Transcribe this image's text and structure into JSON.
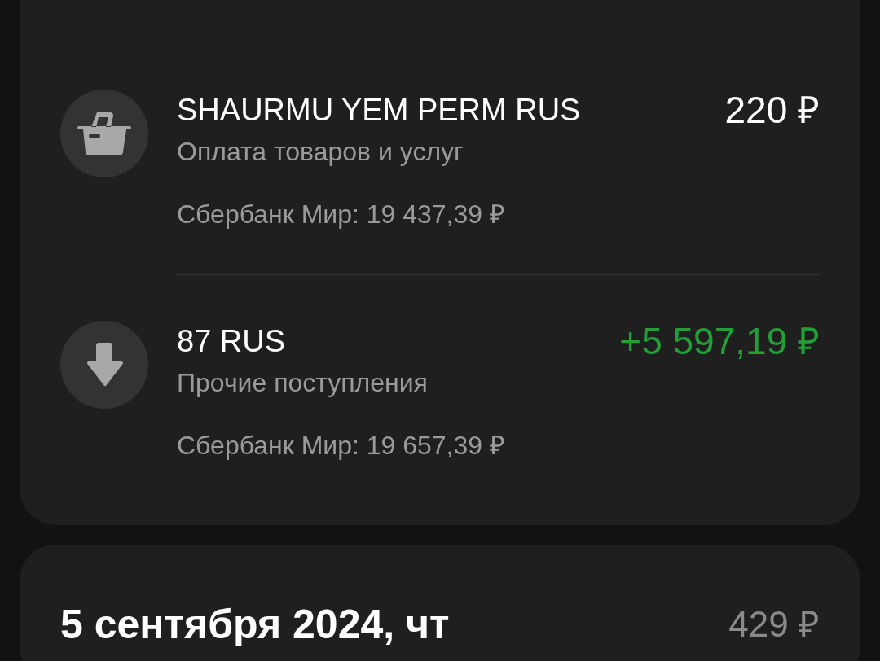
{
  "days": [
    {
      "transactions": [
        {
          "kind": "purchase",
          "title": "SHAURMU YEM PERM RUS",
          "amount": "220 ₽",
          "category": "Оплата товаров и услуг",
          "account": "Сбербанк Мир: 19 437,39 ₽"
        },
        {
          "kind": "income",
          "title": "87 RUS",
          "amount": "+5 597,19 ₽",
          "category": "Прочие поступления",
          "account": "Сбербанк Мир: 19 657,39 ₽"
        }
      ]
    },
    {
      "date": "5 сентября 2024, чт",
      "total": "429 ₽"
    }
  ]
}
